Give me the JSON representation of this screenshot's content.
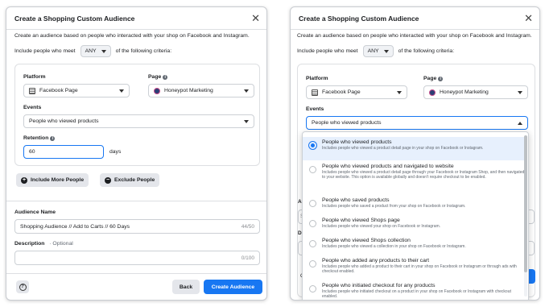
{
  "dialog1": {
    "title": "Create a Shopping Custom Audience",
    "description": "Create an audience based on people who interacted with your shop on Facebook and Instagram.",
    "criteria_prefix": "Include people who meet",
    "criteria_value": "ANY",
    "criteria_suffix": "of the following criteria:",
    "platform_label": "Platform",
    "platform_value": "Facebook Page",
    "page_label": "Page",
    "page_value": "Honeypot Marketing",
    "events_label": "Events",
    "events_value": "People who viewed products",
    "retention_label": "Retention",
    "retention_value": "60",
    "retention_unit": "days",
    "include_more_label": "Include More People",
    "exclude_label": "Exclude People",
    "audience_name_label": "Audience Name",
    "audience_name_value": "Shopping Audience // Add to Carts // 60 Days",
    "audience_name_counter": "44/50",
    "description_label": "Description",
    "description_optional": "· Optional",
    "description_counter": "0/100",
    "back_label": "Back",
    "create_label": "Create Audience"
  },
  "dialog2": {
    "title": "Create a Shopping Custom Audience",
    "description": "Create an audience based on people who interacted with your shop on Facebook and Instagram.",
    "criteria_prefix": "Include people who meet",
    "criteria_value": "ANY",
    "criteria_suffix": "of the following criteria:",
    "platform_label": "Platform",
    "platform_value": "Facebook Page",
    "page_label": "Page",
    "page_value": "Honeypot Marketing",
    "events_label": "Events",
    "events_value": "People who viewed products",
    "peek_au": "Au",
    "peek_de": "De",
    "peek_s": "S",
    "peek_c": "C",
    "peek_0": "0",
    "menu_items": [
      {
        "title": "People who viewed products",
        "desc": "Includes people who viewed a product detail page in your shop on Facebook or Instagram."
      },
      {
        "title": "People who viewed products and navigated to website",
        "desc": "Includes people who viewed a product detail page through your Facebook or Instagram Shop, and then navigated to your website. This option is available globally and doesn't require checkout to be enabled."
      },
      {
        "title": "People who saved products",
        "desc": "Includes people who saved a product from your shop on Facebook or Instagram."
      },
      {
        "title": "People who viewed Shops page",
        "desc": "Includes people who viewed your shop on Facebook or Instagram."
      },
      {
        "title": "People who viewed Shops collection",
        "desc": "Includes people who viewed a collection in your shop on Facebook or Instagram."
      },
      {
        "title": "People who added any products to their cart",
        "desc": "Includes people who added a product to their cart in your shop on Facebook or Instagram or through ads with checkout enabled."
      },
      {
        "title": "People who initiated checkout for any products",
        "desc": "Includes people who initiated checkout on a product in your shop on Facebook or Instagram with checkout enabled."
      }
    ],
    "selected_index": 0
  },
  "colors": {
    "primary": "#1877f2",
    "selected_bg": "#e7f0fd",
    "border": "#ccd0d5"
  }
}
